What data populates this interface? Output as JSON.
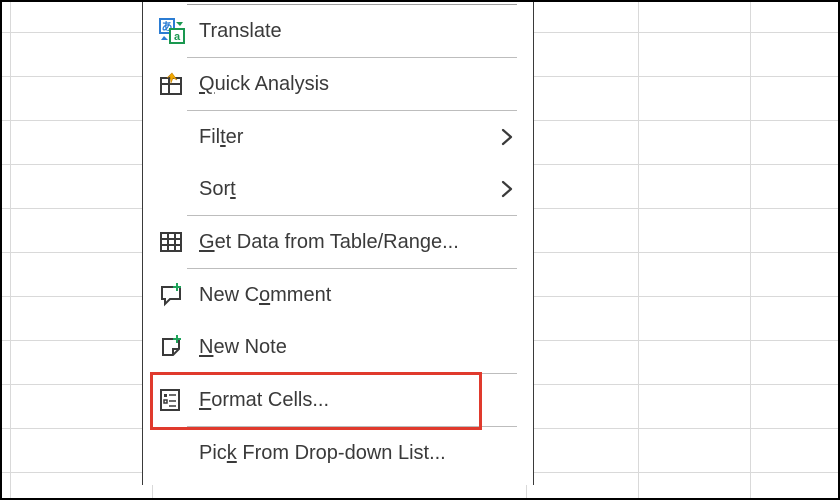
{
  "menu": {
    "items": [
      {
        "label": "Translate",
        "underline_idx": null,
        "icon": "translate-icon",
        "submenu": false
      },
      {
        "label": "Quick Analysis",
        "underline_idx": 0,
        "icon": "quick-analysis-icon",
        "submenu": false
      },
      {
        "label": "Filter",
        "underline_idx": 3,
        "icon": null,
        "submenu": true
      },
      {
        "label": "Sort",
        "underline_idx": 3,
        "icon": null,
        "submenu": true
      },
      {
        "label": "Get Data from Table/Range...",
        "underline_idx": 0,
        "icon": "table-icon",
        "submenu": false
      },
      {
        "label": "New Comment",
        "underline_idx": 5,
        "icon": "new-comment-icon",
        "submenu": false
      },
      {
        "label": "New Note",
        "underline_idx": 0,
        "icon": "new-note-icon",
        "submenu": false
      },
      {
        "label": "Format Cells...",
        "underline_idx": 0,
        "icon": "format-cells-icon",
        "submenu": false
      },
      {
        "label": "Pick From Drop-down List...",
        "underline_idx": 3,
        "icon": null,
        "submenu": false
      }
    ],
    "separators_after": [
      0,
      1,
      3,
      4,
      6,
      7
    ],
    "highlight_index": 7
  }
}
